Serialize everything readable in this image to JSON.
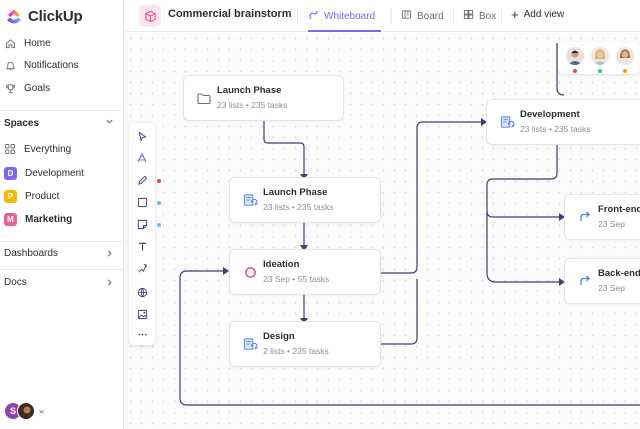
{
  "app": {
    "name": "ClickUp",
    "brand_colors": [
      "#7b68ee",
      "#fd71af",
      "#49ccf9",
      "#ffc800"
    ]
  },
  "sidebar": {
    "nav": [
      {
        "label": "Home",
        "icon": "home-icon"
      },
      {
        "label": "Notifications",
        "icon": "bell-icon"
      },
      {
        "label": "Goals",
        "icon": "trophy-icon"
      }
    ],
    "spaces_title": "Spaces",
    "everything_label": "Everything",
    "spaces": [
      {
        "label": "Development",
        "badge": "D",
        "color": "#7b68ee",
        "active": false
      },
      {
        "label": "Product",
        "badge": "P",
        "color": "#f5b700",
        "active": false
      },
      {
        "label": "Marketing",
        "badge": "M",
        "color": "#ee5e99",
        "active": true
      }
    ],
    "dashboards_label": "Dashboards",
    "docs_label": "Docs",
    "user_initial": "S"
  },
  "header": {
    "title": "Commercial brainstorm",
    "views": [
      {
        "label": "Whiteboard",
        "icon": "whiteboard-icon",
        "active": true
      },
      {
        "label": "Board",
        "icon": "board-icon",
        "active": false
      },
      {
        "label": "Box",
        "icon": "box-icon",
        "active": false
      }
    ],
    "add_view_label": "Add view"
  },
  "toolbar": {
    "tools": [
      "cursor-icon",
      "ai-icon",
      "pen-icon",
      "square-icon",
      "sticky-note-icon",
      "text-icon",
      "connector-icon",
      "globe-icon",
      "image-icon",
      "more-icon"
    ],
    "dot_colors": [
      "#e5484d",
      "#49ccf9",
      "#49ccf9"
    ]
  },
  "cards": [
    {
      "id": "launch-top",
      "title": "Launch Phase",
      "sub": "23 lists  •  235 tasks",
      "icon": "folder-icon"
    },
    {
      "id": "launch-mid",
      "title": "Launch Phase",
      "sub": "23 lists  •  235 tasks",
      "icon": "list-sync-icon"
    },
    {
      "id": "ideation",
      "title": "Ideation",
      "sub": "23 Sep  •  55 tasks",
      "icon": "status-circle-icon"
    },
    {
      "id": "design",
      "title": "Design",
      "sub": "2 lists  •  235 tasks",
      "icon": "list-sync-icon"
    },
    {
      "id": "development",
      "title": "Development",
      "sub": "23 lists  •  235 tasks",
      "icon": "list-sync-icon"
    },
    {
      "id": "frontend",
      "title": "Front-end",
      "sub": "23 Sep",
      "icon": "redo-arrow-icon"
    },
    {
      "id": "backend",
      "title": "Back-end",
      "sub": "23 Sep",
      "icon": "redo-arrow-icon"
    }
  ],
  "collaborators": [
    {
      "name": "collaborator-1",
      "dot": "#e5484d"
    },
    {
      "name": "collaborator-2",
      "dot": "#2ecc71"
    },
    {
      "name": "collaborator-3",
      "dot": "#f59e0b"
    }
  ]
}
